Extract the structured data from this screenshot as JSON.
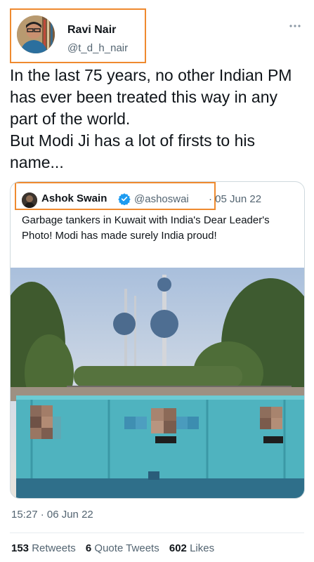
{
  "author": {
    "name": "Ravi Nair",
    "handle": "@t_d_h_nair"
  },
  "tweet_text": "In the last 75 years, no other Indian PM has ever been treated this way in any part of the world.\nBut Modi Ji has a lot of firsts to his name...",
  "quoted": {
    "name": "Ashok Swain",
    "handle": "@ashoswai",
    "date": "· 05 Jun 22",
    "text": "Garbage tankers in Kuwait with India's Dear Leader's Photo! Modi has made surely India proud!"
  },
  "timestamp": "15:27 · 06 Jun 22",
  "stats": {
    "retweets_count": "153",
    "retweets_label": "Retweets",
    "quotes_count": "6",
    "quotes_label": "Quote Tweets",
    "likes_count": "602",
    "likes_label": "Likes"
  },
  "colors": {
    "highlight": "#ef8a2f",
    "verified": "#1d9bf0",
    "secondary_text": "#536471",
    "container": "#4fb3bf"
  },
  "icons": [
    "more-options-icon",
    "verified-badge-icon"
  ]
}
